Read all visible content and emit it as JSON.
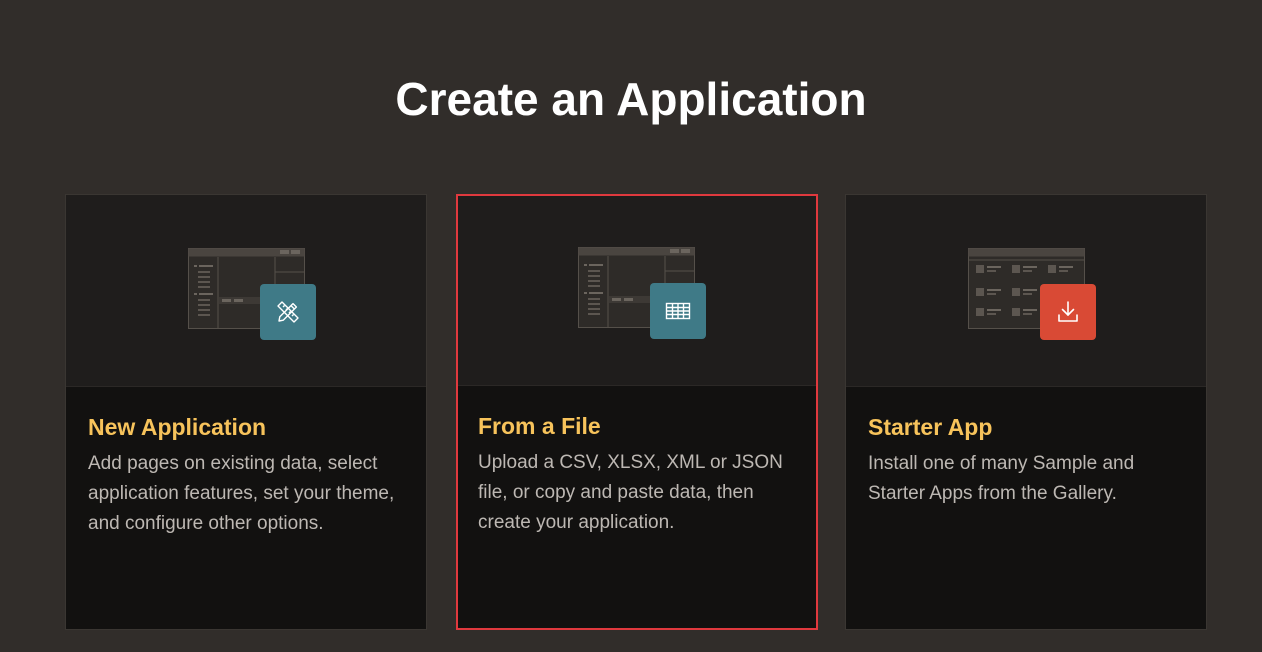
{
  "page": {
    "title": "Create an Application"
  },
  "cards": [
    {
      "title": "New Application",
      "description": "Add pages on existing data, select application features, set your theme, and configure other options.",
      "icon": "pencil-ruler-icon",
      "badge_color": "#3f7a87"
    },
    {
      "title": "From a File",
      "description": "Upload a CSV, XLSX, XML or JSON file, or copy and paste data, then create your application.",
      "icon": "table-grid-icon",
      "badge_color": "#3f7a87",
      "selected": true
    },
    {
      "title": "Starter App",
      "description": "Install one of many Sample and Starter Apps from the Gallery.",
      "icon": "download-icon",
      "badge_color": "#d94a35"
    }
  ],
  "colors": {
    "background": "#312d2a",
    "card_title": "#f7c35b",
    "selection_border": "#e0393e"
  }
}
